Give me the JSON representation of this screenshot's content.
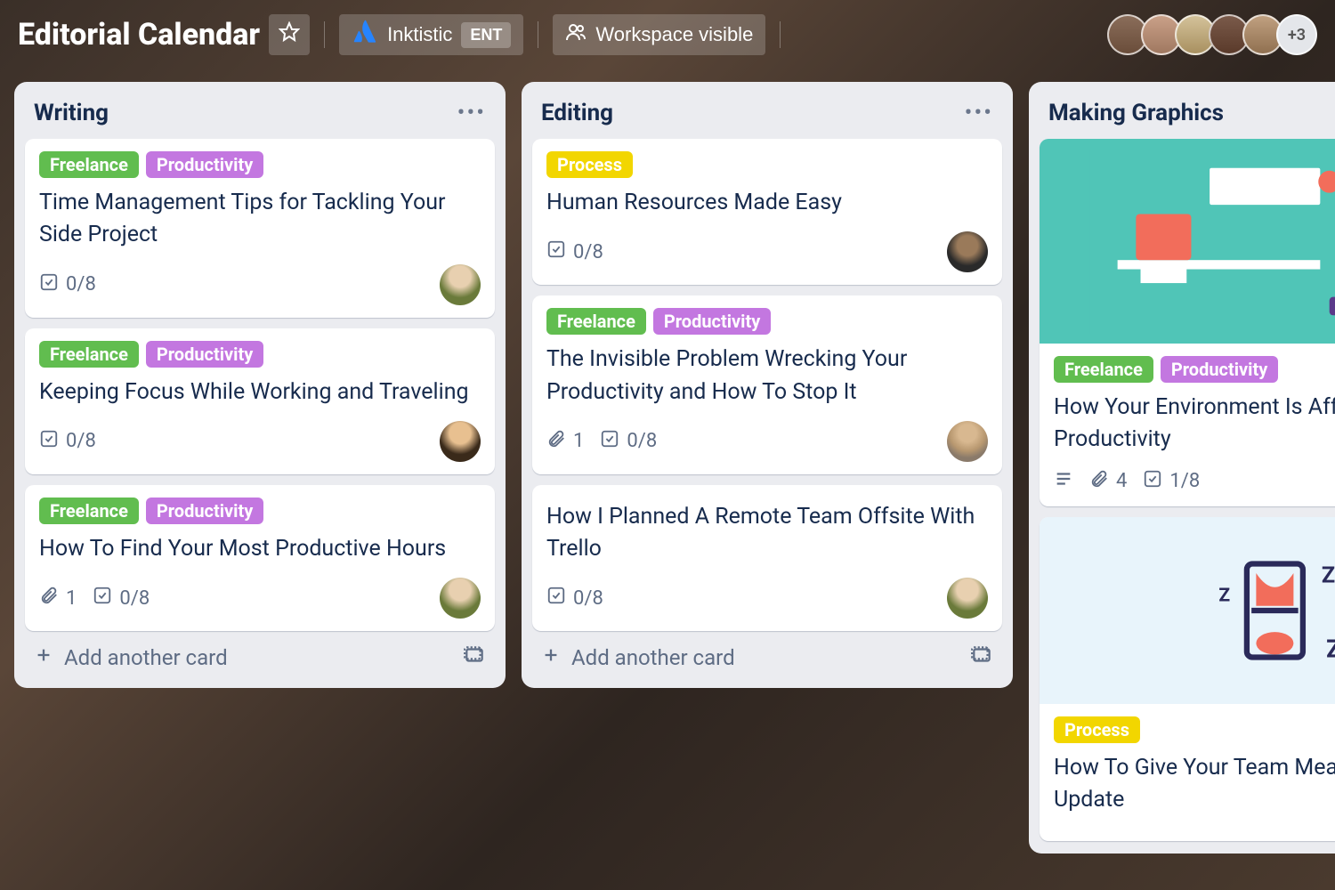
{
  "header": {
    "title": "Editorial Calendar",
    "workspace": "Inktistic",
    "workspace_badge": "ENT",
    "visibility": "Workspace visible",
    "extra_members": "+3"
  },
  "labels": {
    "freelance": "Freelance",
    "productivity": "Productivity",
    "process": "Process"
  },
  "ui": {
    "add_card": "Add another card"
  },
  "lists": [
    {
      "title": "Writing",
      "cards": [
        {
          "labels": [
            "freelance",
            "productivity"
          ],
          "title": "Time Management Tips for Tackling Your Side Project",
          "checklist": "0/8",
          "avatar": "a1"
        },
        {
          "labels": [
            "freelance",
            "productivity"
          ],
          "title": "Keeping Focus While Working and Traveling",
          "checklist": "0/8",
          "avatar": "a2"
        },
        {
          "labels": [
            "freelance",
            "productivity"
          ],
          "title": "How To Find Your Most Productive Hours",
          "attachments": "1",
          "checklist": "0/8",
          "avatar": "a1"
        }
      ]
    },
    {
      "title": "Editing",
      "cards": [
        {
          "labels": [
            "process"
          ],
          "title": "Human Resources Made Easy",
          "checklist": "0/8",
          "avatar": "a3"
        },
        {
          "labels": [
            "freelance",
            "productivity"
          ],
          "title": "The Invisible Problem Wrecking Your Productivity and How To Stop It",
          "attachments": "1",
          "checklist": "0/8",
          "avatar": "a4"
        },
        {
          "labels": [],
          "title": "How I Planned A Remote Team Offsite With Trello",
          "checklist": "0/8",
          "avatar": "a1"
        }
      ]
    },
    {
      "title": "Making Graphics",
      "cards": [
        {
          "cover": true,
          "labels": [
            "freelance",
            "productivity"
          ],
          "title": "How Your Environment Is Affecting Your Productivity",
          "description": true,
          "attachments": "4",
          "checklist": "1/8"
        },
        {
          "cover2": true,
          "labels": [
            "process"
          ],
          "title": "How To Give Your Team Meaningful Status Update"
        }
      ]
    }
  ]
}
